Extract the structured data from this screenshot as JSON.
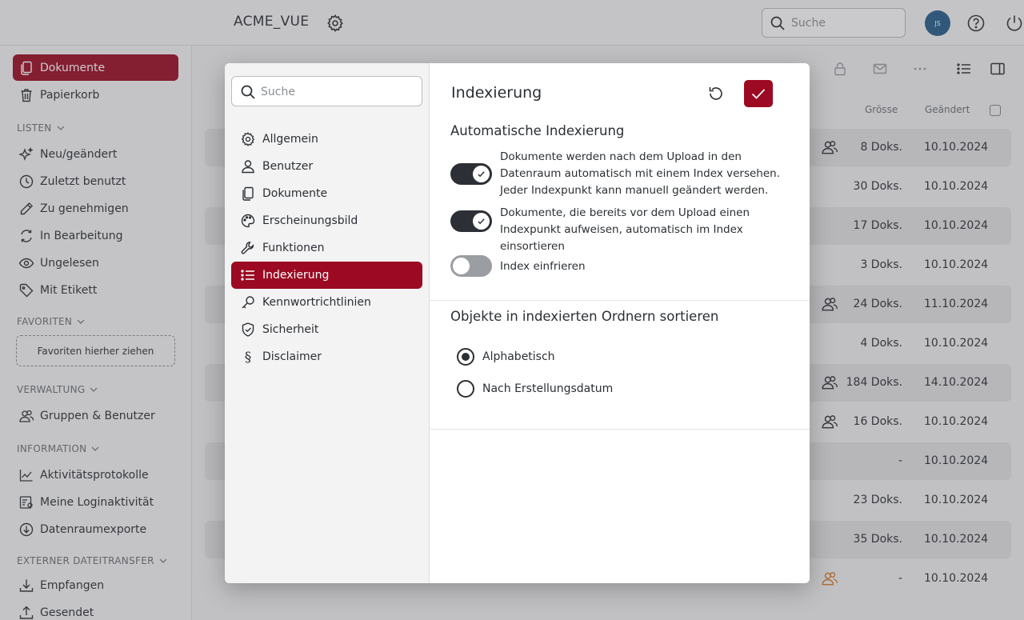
{
  "header": {
    "app_title": "ACME_VUE",
    "search_placeholder": "Suche",
    "avatar_initials": "JS"
  },
  "sidebar": {
    "top_items": [
      {
        "label": "Dokumente",
        "icon": "documents-icon",
        "active": true
      },
      {
        "label": "Papierkorb",
        "icon": "trash-icon"
      }
    ],
    "sections": {
      "listen": "LISTEN",
      "favoriten": "FAVORITEN",
      "verwaltung": "VERWALTUNG",
      "information": "INFORMATION",
      "extern": "EXTERNER DATEITRANSFER"
    },
    "listen_items": [
      {
        "label": "Neu/geändert",
        "icon": "sparkle-icon"
      },
      {
        "label": "Zuletzt benutzt",
        "icon": "clock-icon"
      },
      {
        "label": "Zu genehmigen",
        "icon": "pencil-icon"
      },
      {
        "label": "In Bearbeitung",
        "icon": "sync-icon"
      },
      {
        "label": "Ungelesen",
        "icon": "eye-icon"
      },
      {
        "label": "Mit Etikett",
        "icon": "tag-icon"
      }
    ],
    "favorites_drop": "Favoriten hierher ziehen",
    "verwaltung_items": [
      {
        "label": "Gruppen & Benutzer",
        "icon": "users-icon"
      }
    ],
    "information_items": [
      {
        "label": "Aktivitätsprotokolle",
        "icon": "activity-chart-icon"
      },
      {
        "label": "Meine Loginaktivität",
        "icon": "login-activity-icon"
      },
      {
        "label": "Datenraumexporte",
        "icon": "download-circle-icon"
      }
    ],
    "extern_items": [
      {
        "label": "Empfangen",
        "icon": "download-tray-icon"
      },
      {
        "label": "Gesendet",
        "icon": "upload-tray-icon"
      }
    ]
  },
  "table": {
    "col_size": "Grösse",
    "col_changed": "Geändert",
    "rows": [
      {
        "size": "8 Doks.",
        "date": "10.10.2024",
        "group": true
      },
      {
        "size": "30 Doks.",
        "date": "10.10.2024",
        "group": false
      },
      {
        "size": "17 Doks.",
        "date": "10.10.2024",
        "group": false
      },
      {
        "size": "3 Doks.",
        "date": "10.10.2024",
        "group": false
      },
      {
        "size": "24 Doks.",
        "date": "11.10.2024",
        "group": true
      },
      {
        "size": "4 Doks.",
        "date": "10.10.2024",
        "group": false
      },
      {
        "size": "184 Doks.",
        "date": "14.10.2024",
        "group": true
      },
      {
        "size": "16 Doks.",
        "date": "10.10.2024",
        "group": true
      },
      {
        "size": "-",
        "date": "10.10.2024",
        "group": false
      },
      {
        "size": "23 Doks.",
        "date": "10.10.2024",
        "group": false
      },
      {
        "size": "35 Doks.",
        "date": "10.10.2024",
        "group": false
      },
      {
        "size": "-",
        "date": "10.10.2024",
        "group": true
      }
    ]
  },
  "settings": {
    "search_placeholder": "Suche",
    "menu": [
      {
        "label": "Allgemein",
        "icon": "gear-icon"
      },
      {
        "label": "Benutzer",
        "icon": "user-icon"
      },
      {
        "label": "Dokumente",
        "icon": "documents-icon"
      },
      {
        "label": "Erscheinungsbild",
        "icon": "palette-icon"
      },
      {
        "label": "Funktionen",
        "icon": "wrench-icon"
      },
      {
        "label": "Indexierung",
        "icon": "list-icon",
        "active": true
      },
      {
        "label": "Kennwortrichtlinien",
        "icon": "key-icon"
      },
      {
        "label": "Sicherheit",
        "icon": "shield-check-icon"
      },
      {
        "label": "Disclaimer",
        "icon": "section-sign-icon"
      }
    ],
    "title": "Indexierung",
    "auto_section_title": "Automatische Indexierung",
    "toggles": [
      {
        "label": "Dokumente werden nach dem Upload in den Datenraum automatisch mit einem Index versehen. Jeder Indexpunkt kann manuell geändert werden.",
        "on": true
      },
      {
        "label": "Dokumente, die bereits vor dem Upload einen Indexpunkt aufweisen, automatisch im Index einsortieren",
        "on": true
      },
      {
        "label": "Index einfrieren",
        "on": false
      }
    ],
    "sort_section_title": "Objekte in indexierten Ordnern sortieren",
    "sort_options": [
      {
        "label": "Alphabetisch",
        "checked": true
      },
      {
        "label": "Nach Erstellungsdatum",
        "checked": false
      }
    ]
  },
  "colors": {
    "accent": "#9b0a22",
    "toggle_on": "#2c3036",
    "avatar": "#245c8a"
  }
}
